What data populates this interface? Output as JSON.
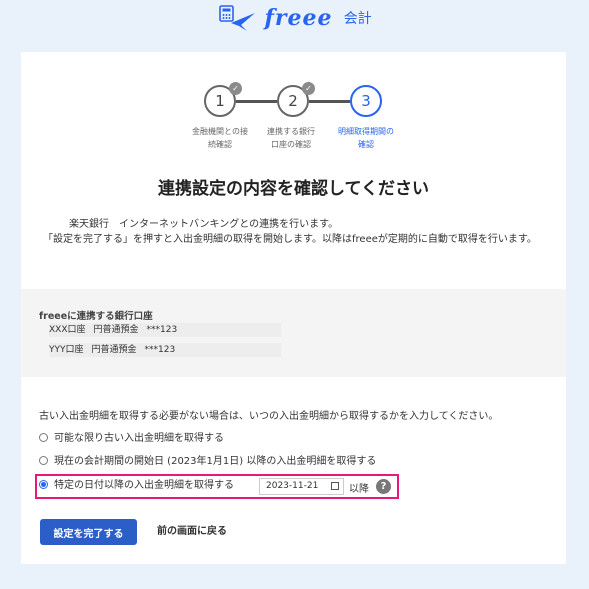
{
  "header": {
    "logo_word": "freee",
    "logo_sub": "会計"
  },
  "stepper": {
    "steps": [
      {
        "number": "1",
        "label": "金融機関との接続確認",
        "done": true
      },
      {
        "number": "2",
        "label": "連携する銀行口座の確認",
        "done": true
      },
      {
        "number": "3",
        "label": "明細取得期間の確認",
        "done": false
      }
    ]
  },
  "page_title": "連携設定の内容を確認してください",
  "description": {
    "line1": "楽天銀行　インターネットバンキングとの連携を行います。",
    "line2": "「設定を完了する」を押すと入出金明細の取得を開始します。以降はfreeeが定期的に自動で取得を行います。"
  },
  "bank_accounts": {
    "heading": "freeeに連携する銀行口座",
    "accounts": [
      {
        "name": "XXX口座",
        "type": "円普通預金",
        "number": "***123"
      },
      {
        "name": "YYY口座",
        "type": "円普通預金",
        "number": "***123"
      }
    ]
  },
  "fetch_options": {
    "question": "古い入出金明細を取得する必要がない場合は、いつの入出金明細から取得するかを入力してください。",
    "options": [
      {
        "label": "可能な限り古い入出金明細を取得する",
        "selected": false
      },
      {
        "label": "現在の会計期間の開始日 (2023年1月1日) 以降の入出金明細を取得する",
        "selected": false
      },
      {
        "label": "特定の日付以降の入出金明細を取得する",
        "selected": true
      }
    ],
    "date_value": "2023-11-21",
    "after_label": "以降",
    "help_glyph": "?"
  },
  "actions": {
    "complete_label": "設定を完了する",
    "back_label": "前の画面に戻る"
  },
  "colors": {
    "accent": "#2864f0",
    "button": "#2b5ec7",
    "highlight": "#e8177a"
  }
}
